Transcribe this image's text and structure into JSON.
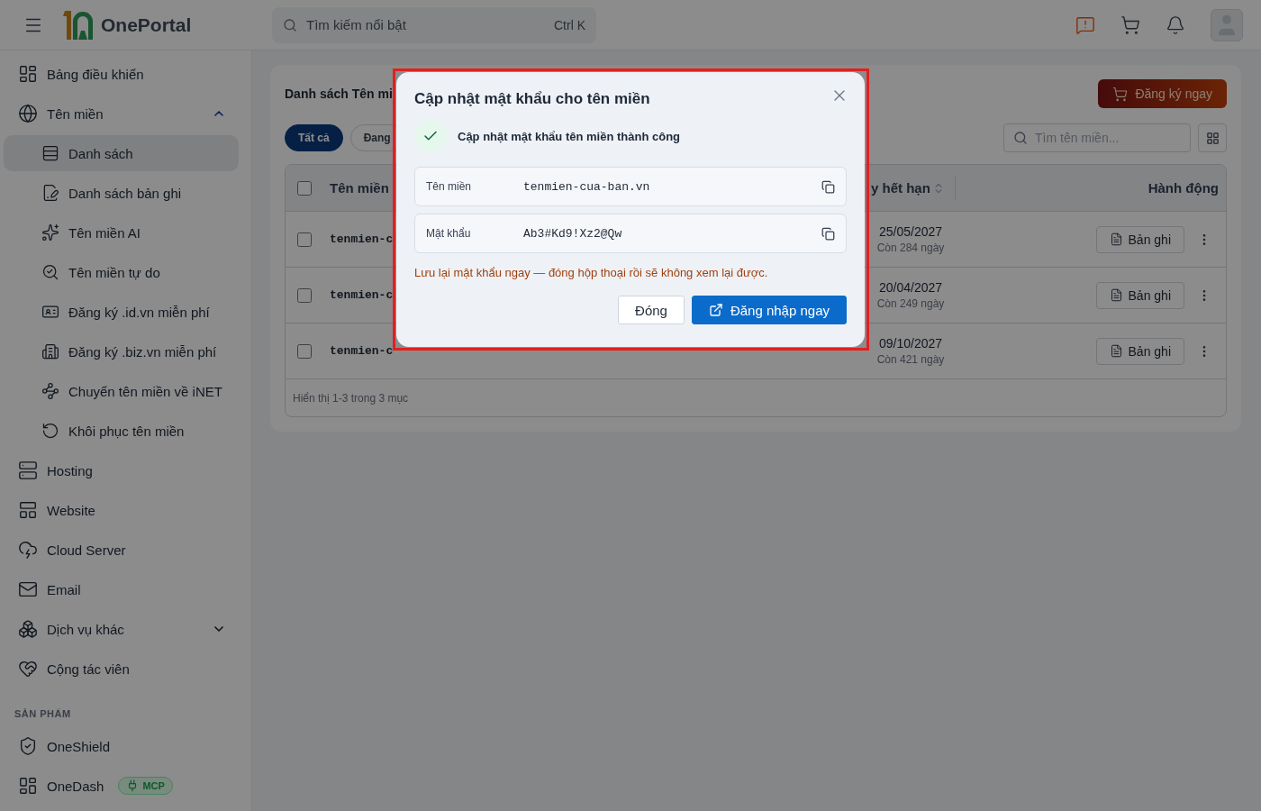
{
  "header": {
    "logo_text": "OnePortal",
    "search": {
      "placeholder": "Tìm kiếm nổi bật",
      "shortcut": "Ctrl K"
    }
  },
  "sidebar": {
    "items": [
      {
        "label": "Bảng điều khiển",
        "selected": false
      },
      {
        "label": "Tên miền",
        "selected": false,
        "expanded": true,
        "children": [
          {
            "label": "Danh sách",
            "selected": true
          },
          {
            "label": "Danh sách bản ghi",
            "selected": false
          },
          {
            "label": "Tên miền AI",
            "selected": false
          },
          {
            "label": "Tên miền tự do",
            "selected": false
          },
          {
            "label": "Đăng ký .id.vn miễn phí",
            "selected": false
          },
          {
            "label": "Đăng ký .biz.vn miễn phí",
            "selected": false
          },
          {
            "label": "Chuyển tên miền về iNET",
            "selected": false
          },
          {
            "label": "Khôi phục tên miền",
            "selected": false
          }
        ]
      },
      {
        "label": "Hosting",
        "selected": false
      },
      {
        "label": "Website",
        "selected": false
      },
      {
        "label": "Cloud Server",
        "selected": false
      },
      {
        "label": "Email",
        "selected": false
      },
      {
        "label": "Dịch vụ khác",
        "selected": false,
        "expanded": false
      },
      {
        "label": "Cộng tác viên",
        "selected": false
      }
    ],
    "section_title": "SẢN PHẨM",
    "products": [
      {
        "label": "OneShield"
      },
      {
        "label": "OneDash",
        "badge": "MCP"
      }
    ]
  },
  "main": {
    "title": "Danh sách Tên mi",
    "register_button": "Đăng ký ngay",
    "filters": [
      {
        "label": "Tất cả",
        "selected": true
      },
      {
        "label": "Đang",
        "selected": false
      }
    ],
    "search": {
      "placeholder": "Tìm tên miền..."
    },
    "table": {
      "select_all_checked": false,
      "columns": [
        {
          "label": "Tên miền",
          "sortable": false
        },
        {
          "label": "y hết hạn",
          "sortable": true
        },
        {
          "label": "Hành động",
          "sortable": false
        }
      ],
      "rows": [
        {
          "checked": false,
          "domain": "tenmien-c",
          "expiry": "25/05/2027",
          "remaining": "Còn 284 ngày",
          "action": "Bản ghi"
        },
        {
          "checked": false,
          "domain": "tenmien-c",
          "expiry": "20/04/2027",
          "remaining": "Còn 249 ngày",
          "action": "Bản ghi"
        },
        {
          "checked": false,
          "domain": "tenmien-c",
          "expiry": "09/10/2027",
          "remaining": "Còn 421 ngày",
          "action": "Bản ghi"
        }
      ],
      "footer": "Hiển thị 1-3 trong 3 mục"
    }
  },
  "dialog": {
    "highlighted": true,
    "title": "Cập nhật mật khẩu cho tên miền",
    "success_message": "Cập nhật mật khẩu tên miền thành công",
    "fields": [
      {
        "label": "Tên miền",
        "value": "tenmien-cua-ban.vn"
      },
      {
        "label": "Mật khẩu",
        "value": "Ab3#Kd9!Xz2@Qw"
      }
    ],
    "warning": "Lưu lại mật khẩu ngay — đóng hộp thoại rồi sẽ không xem lại được.",
    "buttons": [
      {
        "label": "Đóng",
        "kind": "secondary"
      },
      {
        "label": "Đăng nhập ngay",
        "kind": "primary"
      }
    ]
  }
}
